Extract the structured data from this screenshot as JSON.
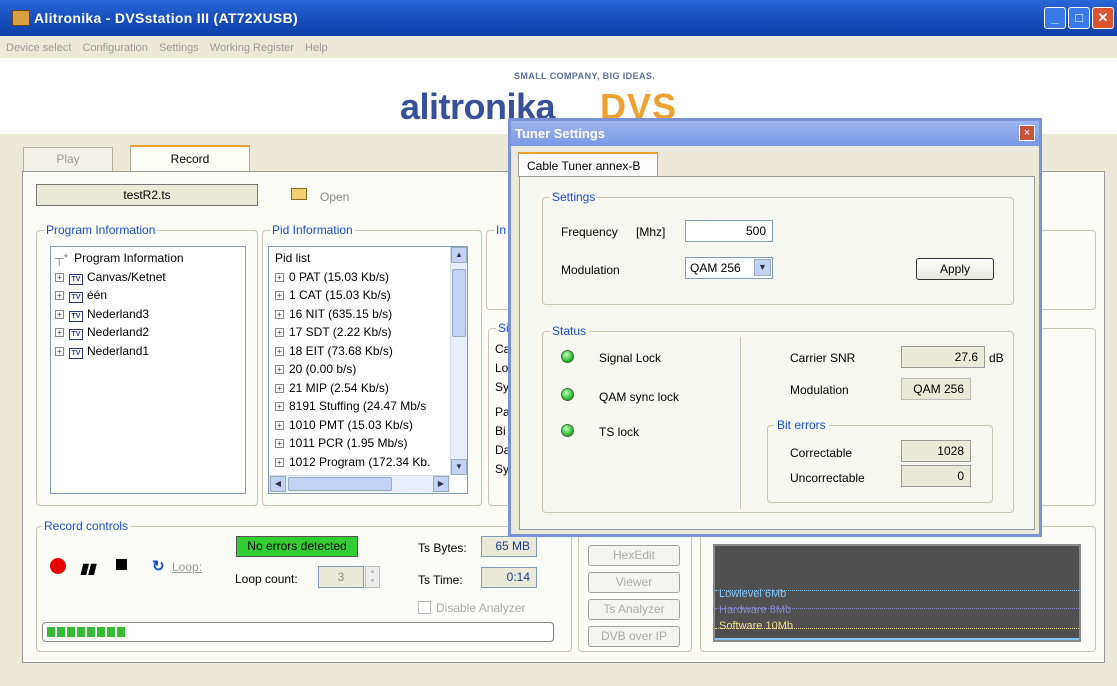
{
  "window": {
    "title": "Alitronika - DVSstation III  (AT72XUSB)"
  },
  "menu": [
    "Device select",
    "Configuration",
    "Settings",
    "Working Register",
    "Help"
  ],
  "banner": {
    "tagline": "SMALL COMPANY, BIG IDEAS.",
    "brand": "alitronika",
    "brand_suffix": "DVS"
  },
  "tabs": {
    "play": "Play",
    "record": "Record"
  },
  "file": {
    "name": "testR2.ts",
    "open_label": "Open"
  },
  "program_info": {
    "title": "Program Information",
    "root": "Program Information",
    "tv_icon": "TV",
    "items": [
      "Canvas/Ketnet",
      "één",
      "Nederland3",
      "Nederland2",
      "Nederland1"
    ]
  },
  "pid_info": {
    "title": "Pid Information",
    "root": "Pid list",
    "items": [
      "0 PAT (15.03 Kb/s)",
      "1 CAT (15.03 Kb/s)",
      "16 NIT (635.15 b/s)",
      "17 SDT (2.22 Kb/s)",
      "18 EIT (73.68 Kb/s)",
      "20  (0.00 b/s)",
      "21 MIP (2.54 Kb/s)",
      "8191 Stuffing (24.47 Mb/s",
      "1010 PMT (15.03 Kb/s)",
      "1011 PCR (1.95 Mb/s)",
      "1012 Program (172.34 Kb."
    ]
  },
  "hidden_fragments": {
    "in": "In",
    "si": "Si",
    "lines": [
      "Ca",
      "Lo",
      "Sy",
      "Pa",
      "Bi",
      "Da",
      "Sy"
    ]
  },
  "record": {
    "title": "Record controls",
    "status": "No errors detected",
    "loop_label": "Loop:",
    "loop_count_label": "Loop count:",
    "loop_count": "3",
    "ts_bytes_label": "Ts Bytes:",
    "ts_bytes": "65 MB",
    "ts_time_label": "Ts Time:",
    "ts_time": "0:14",
    "disable_analyzer": "Disable Analyzer",
    "progress": 0.16
  },
  "buttons": {
    "hexedit": "HexEdit",
    "viewer": "Viewer",
    "ts_analyzer": "Ts Analyzer",
    "dvb_over_ip": "DVB over IP"
  },
  "graph": {
    "lines": [
      {
        "label": "Lowlevel 6Mb",
        "color": "#7fc8ff"
      },
      {
        "label": "Hardware 8Mb",
        "color": "#8a8ad0"
      },
      {
        "label": "Software 10Mb",
        "color": "#f0e090"
      }
    ]
  },
  "dialog": {
    "title": "Tuner Settings",
    "close_glyph": "×",
    "tab": "Cable Tuner annex-B",
    "settings_title": "Settings",
    "frequency_label": "Frequency",
    "frequency_unit": "[Mhz]",
    "frequency_value": "500",
    "modulation_label": "Modulation",
    "modulation_value": "QAM 256",
    "apply": "Apply",
    "status_title": "Status",
    "locks": [
      "Signal Lock",
      "QAM sync lock",
      "TS lock"
    ],
    "carrier_snr_label": "Carrier SNR",
    "carrier_snr_value": "27.6",
    "carrier_snr_unit": "dB",
    "status_modulation_label": "Modulation",
    "status_modulation_value": "QAM 256",
    "bit_errors_title": "Bit errors",
    "correctable_label": "Correctable",
    "correctable_value": "1028",
    "uncorrectable_label": "Uncorrectable",
    "uncorrectable_value": "0"
  }
}
